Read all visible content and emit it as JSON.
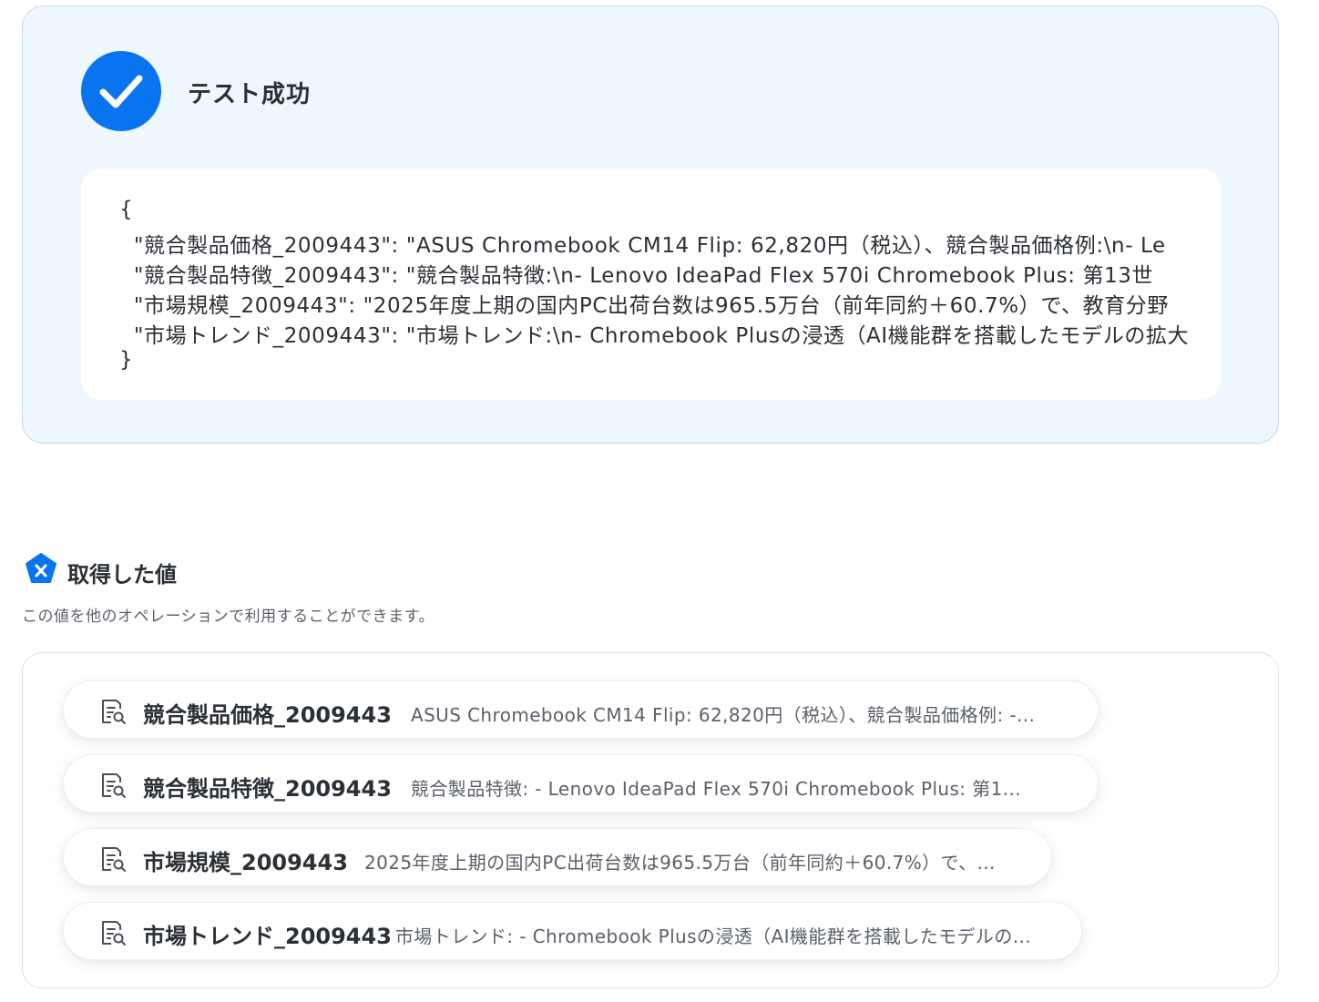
{
  "result": {
    "status_title": "テスト成功",
    "json_lines": [
      "{",
      "  \"競合製品価格_2009443\": \"ASUS Chromebook CM14 Flip: 62,820円（税込）、競合製品価格例:\\n- Le",
      "  \"競合製品特徴_2009443\": \"競合製品特徴:\\n- Lenovo IdeaPad Flex 570i Chromebook Plus: 第13世",
      "  \"市場規模_2009443\": \"2025年度上期の国内PC出荷台数は965.5万台（前年同約＋60.7%）で、教育分野",
      "  \"市場トレンド_2009443\": \"市場トレンド:\\n- Chromebook Plusの浸透（AI機能群を搭載したモデルの拡大",
      "}"
    ]
  },
  "values_section": {
    "title": "取得した値",
    "description": "この値を他のオペレーションで利用することができます。",
    "items": [
      {
        "name": "競合製品価格_2009443",
        "value": "ASUS Chromebook CM14 Flip: 62,820円（税込）、競合製品価格例: -..."
      },
      {
        "name": "競合製品特徴_2009443",
        "value": "競合製品特徴: - Lenovo IdeaPad Flex 570i Chromebook Plus: 第1..."
      },
      {
        "name": "市場規模_2009443",
        "value": "2025年度上期の国内PC出荷台数は965.5万台（前年同約＋60.7%）で、..."
      },
      {
        "name": "市場トレンド_2009443",
        "value": "市場トレンド: - Chromebook Plusの浸透（AI機能群を搭載したモデルの..."
      }
    ]
  },
  "colors": {
    "accent": "#0a74f0",
    "panel_bg": "#eef6fe"
  },
  "icons": {
    "status": "check-icon",
    "section": "variable-badge-icon",
    "item": "document-search-icon"
  }
}
